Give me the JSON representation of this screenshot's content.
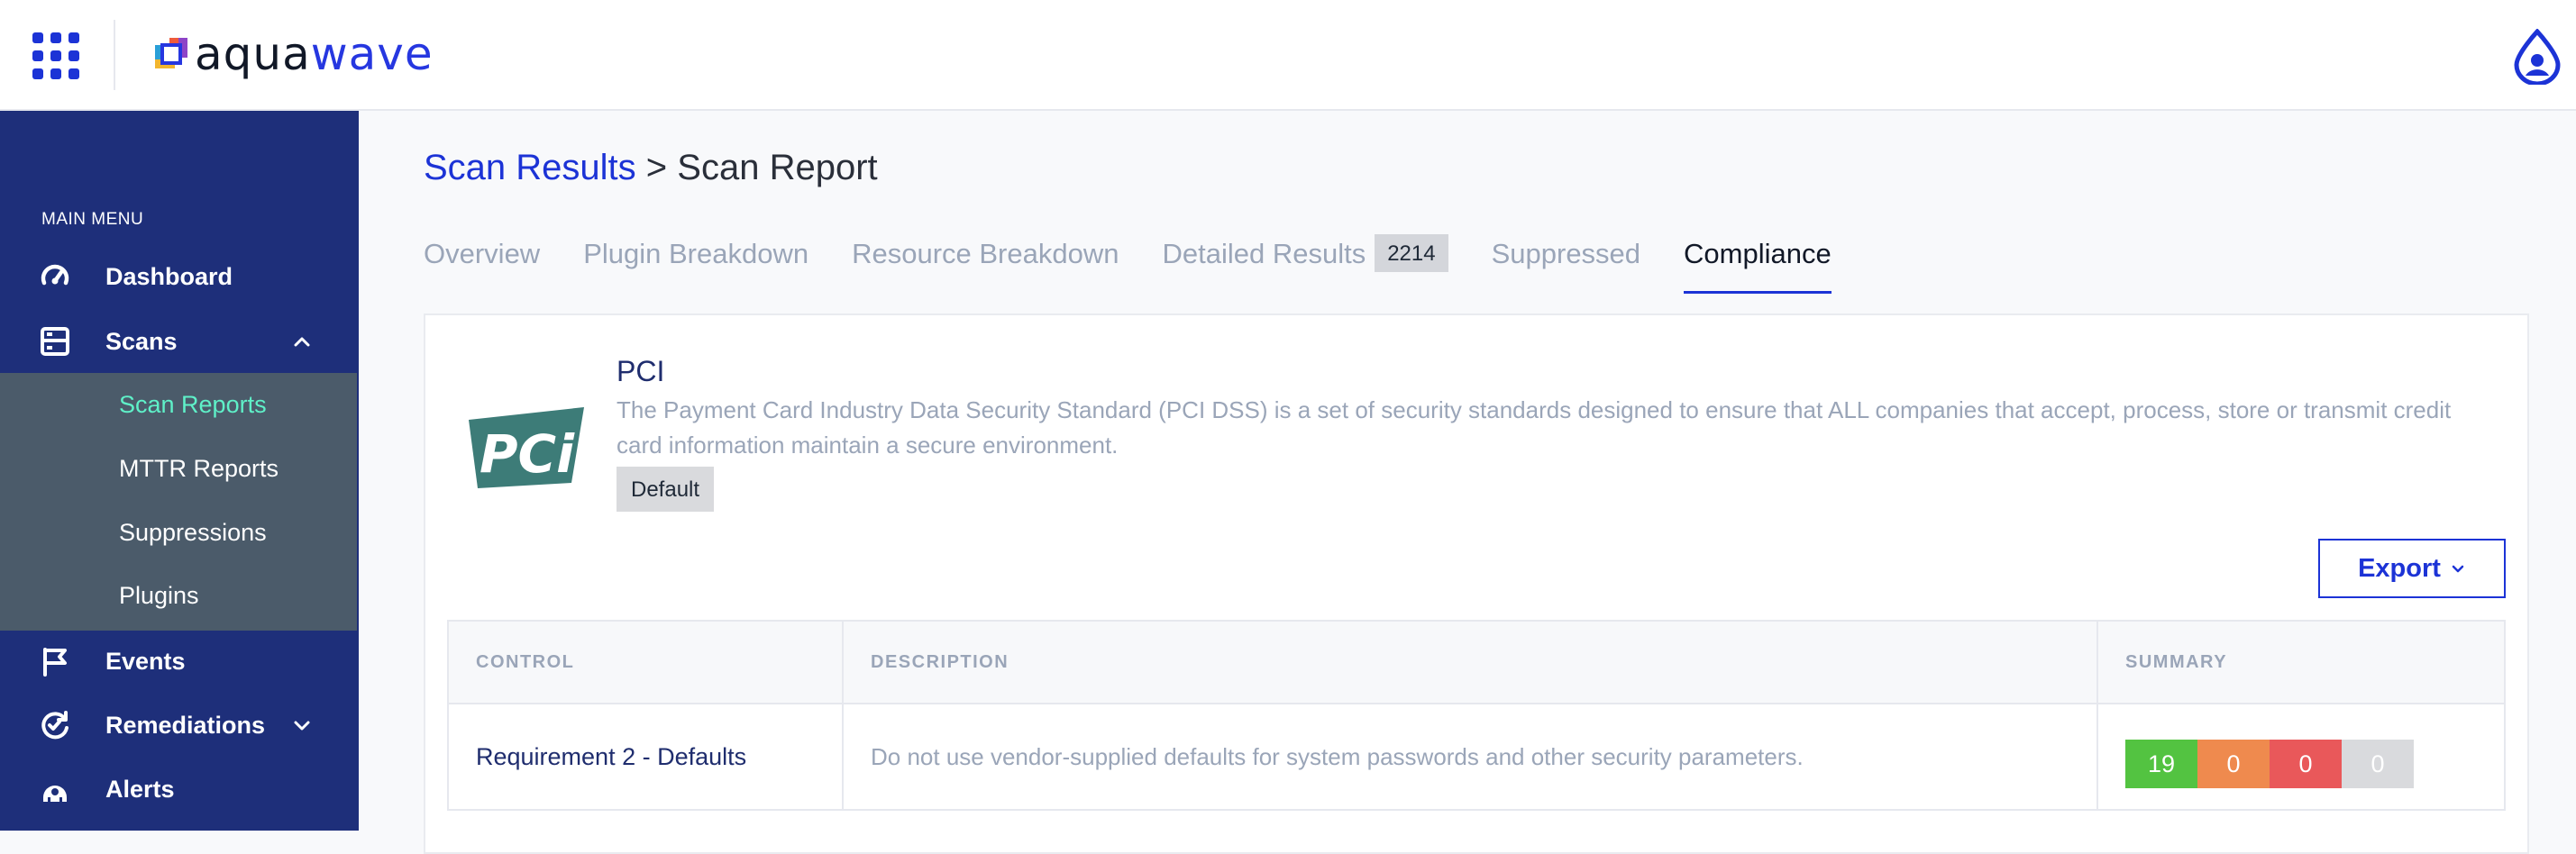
{
  "brand": {
    "part1": "aqua",
    "part2": "wave"
  },
  "icons": {
    "apps": "apps-grid-icon",
    "user": "user-drop-icon"
  },
  "sidebar": {
    "heading": "MAIN MENU",
    "items": [
      {
        "label": "Dashboard",
        "icon": "gauge-icon"
      },
      {
        "label": "Scans",
        "icon": "scans-icon",
        "expanded": true
      },
      {
        "label": "Events",
        "icon": "flag-icon"
      },
      {
        "label": "Remediations",
        "icon": "remediation-icon",
        "expanded": false
      },
      {
        "label": "Alerts",
        "icon": "alert-icon"
      }
    ],
    "sub_items": [
      {
        "label": "Scan Reports",
        "active": true
      },
      {
        "label": "MTTR Reports"
      },
      {
        "label": "Suppressions"
      },
      {
        "label": "Plugins"
      }
    ]
  },
  "breadcrumb": {
    "link": "Scan Results",
    "separator": ">",
    "current": "Scan Report"
  },
  "tabs": [
    {
      "label": "Overview"
    },
    {
      "label": "Plugin Breakdown"
    },
    {
      "label": "Resource Breakdown"
    },
    {
      "label": "Detailed Results",
      "count": "2214"
    },
    {
      "label": "Suppressed"
    },
    {
      "label": "Compliance",
      "active": true
    }
  ],
  "standard": {
    "logo_text": "PCi",
    "title": "PCI",
    "description": "The Payment Card Industry Data Security Standard (PCI DSS) is a set of security standards designed to ensure that ALL companies that accept, process, store or transmit credit card information maintain a secure environment.",
    "badge": "Default"
  },
  "export_label": "Export",
  "table": {
    "headers": [
      "CONTROL",
      "DESCRIPTION",
      "SUMMARY"
    ],
    "rows": [
      {
        "control": "Requirement 2 - Defaults",
        "description": "Do not use vendor-supplied defaults for system passwords and other security parameters.",
        "summary": [
          "19",
          "0",
          "0",
          "0"
        ]
      }
    ]
  },
  "colors": {
    "accent": "#1c33d6",
    "sidebar": "#1e2f7a",
    "sub_panel": "#4b5b6a",
    "active_sub": "#5ff0c8",
    "summary": [
      "#53c341",
      "#ef8a4e",
      "#e9585a",
      "#d9dadd"
    ]
  }
}
